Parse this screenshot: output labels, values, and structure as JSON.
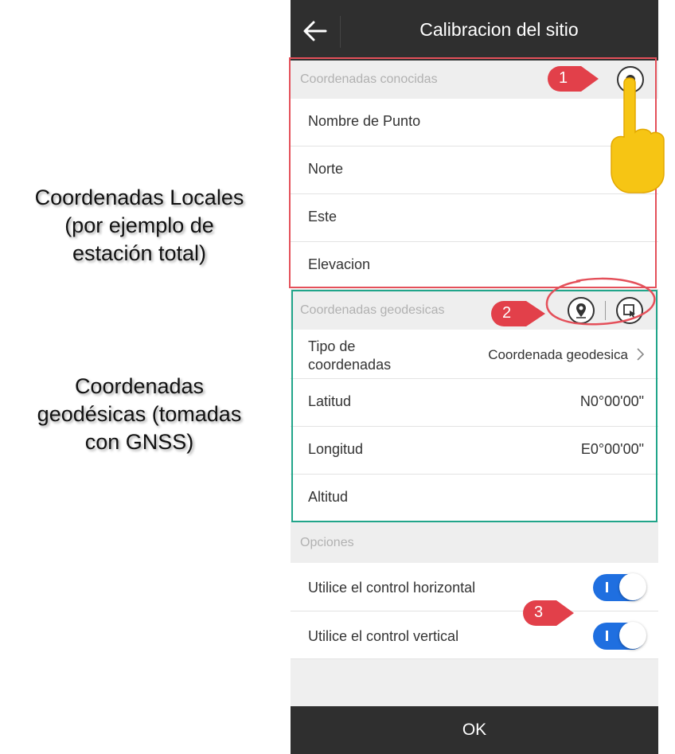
{
  "annotations": {
    "local_label": [
      "Coordenadas Locales",
      "(por ejemplo de",
      "estación total)"
    ],
    "geodetic_label": [
      "Coordenadas",
      "geodésicas (tomadas",
      "con GNSS)"
    ],
    "badges": [
      "1",
      "2",
      "3"
    ]
  },
  "header": {
    "title": "Calibracion del sitio"
  },
  "known": {
    "title": "Coordenadas conocidas",
    "rows": [
      "Nombre de Punto",
      "Norte",
      "Este",
      "Elevacion"
    ]
  },
  "geodetic": {
    "title": "Coordenadas geodesicas",
    "coord_type_label": [
      "Tipo de",
      "coordenadas"
    ],
    "coord_type_value": "Coordenada geodesica",
    "latitude_label": "Latitud",
    "latitude_value": "N0°00'00\"",
    "longitude_label": "Longitud",
    "longitude_value": "E0°00'00\"",
    "altitude_label": "Altitud"
  },
  "options": {
    "title": "Opciones",
    "horizontal_label": "Utilice el control horizontal",
    "vertical_label": "Utilice el control vertical",
    "horizontal_on": true,
    "vertical_on": true
  },
  "footer": {
    "ok_label": "OK"
  },
  "colors": {
    "accent": "#1f6fe0",
    "red_annotation": "#e4505a",
    "green_annotation": "#21a58a",
    "bar": "#2f2f2f"
  }
}
